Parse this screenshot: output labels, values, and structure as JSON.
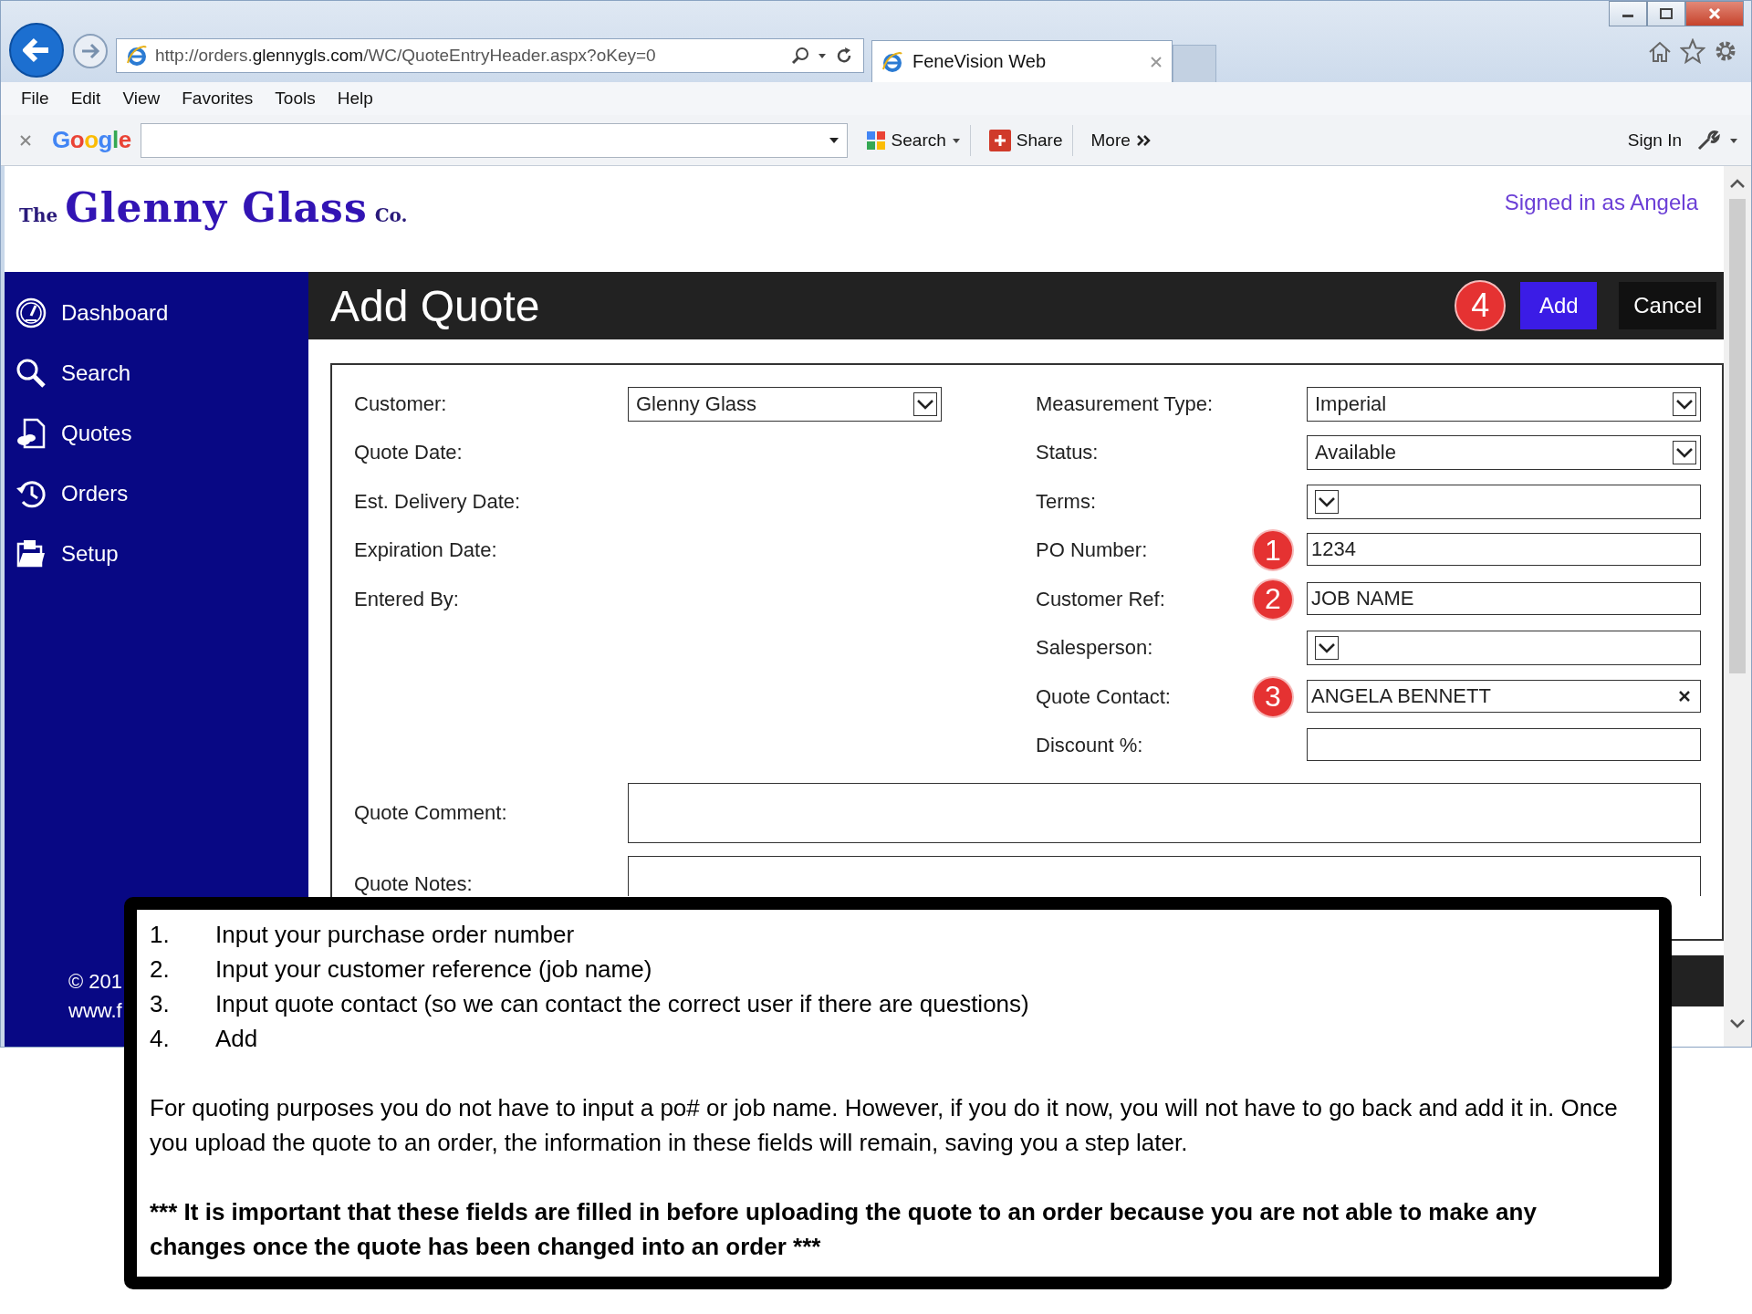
{
  "browser": {
    "url": "http://orders.**glennygls.com**/WC/QuoteEntryHeader.aspx?oKey=0",
    "tab_title": "FeneVision Web",
    "menu": [
      "File",
      "Edit",
      "View",
      "Favorites",
      "Tools",
      "Help"
    ],
    "toolbar": {
      "logo": "Google",
      "search": "Search",
      "share": "Share",
      "more": "More",
      "sign_in": "Sign In"
    }
  },
  "page": {
    "logo": {
      "prefix": "The",
      "name": "Glenny Glass",
      "suffix": "Co."
    },
    "signed_in": "Signed in as Angela",
    "sidebar": {
      "items": [
        {
          "label": "Dashboard"
        },
        {
          "label": "Search"
        },
        {
          "label": "Quotes"
        },
        {
          "label": "Orders"
        },
        {
          "label": "Setup"
        }
      ],
      "footer": [
        "© 201",
        "www.f"
      ]
    },
    "header": {
      "title": "Add Quote",
      "buttons": [
        {
          "label": "Add",
          "kind": "primary",
          "callout": "4"
        },
        {
          "label": "Cancel",
          "kind": "secondary"
        }
      ]
    },
    "form": {
      "left": [
        {
          "label": "Customer:",
          "kind": "select",
          "value": "Glenny Glass"
        },
        {
          "label": "Quote Date:",
          "kind": "none"
        },
        {
          "label": "Est. Delivery Date:",
          "kind": "none"
        },
        {
          "label": "Expiration Date:",
          "kind": "none"
        },
        {
          "label": "Entered By:",
          "kind": "none"
        }
      ],
      "right": [
        {
          "label": "Measurement Type:",
          "kind": "select",
          "value": "Imperial"
        },
        {
          "label": "Status:",
          "kind": "select",
          "value": "Available"
        },
        {
          "label": "Terms:",
          "kind": "select"
        },
        {
          "label": "PO Number:",
          "kind": "input",
          "value": "1234",
          "callout": "1"
        },
        {
          "label": "Customer Ref:",
          "kind": "input",
          "value": "JOB NAME",
          "callout": "2"
        },
        {
          "label": "Salesperson:",
          "kind": "select"
        },
        {
          "label": "Quote Contact:",
          "kind": "input",
          "value": "ANGELA BENNETT",
          "callout": "3",
          "clearable": true
        },
        {
          "label": "Discount %:",
          "kind": "input"
        }
      ],
      "notes": [
        {
          "label": "Quote Comment:"
        },
        {
          "label": "Quote Notes:"
        }
      ]
    }
  },
  "overlay": {
    "steps": [
      {
        "number": "1.",
        "text": "Input your purchase order number"
      },
      {
        "number": "2.",
        "text": "Input your customer reference (job name)"
      },
      {
        "number": "3.",
        "text": "Input quote contact (so we can contact the correct user if there are questions)"
      },
      {
        "number": "4.",
        "text": "Add"
      }
    ],
    "paragraph": "For quoting purposes you do not have to input a po# or job name.  However, if you do it now, you will not have to go back and add it in.  Once you upload the quote to an order, the information in these fields will remain, saving you a step later.",
    "warning": "***  It is important that these fields are filled in before uploading the quote to an order because you are not able to make any changes once the quote has been changed into an order ***"
  }
}
